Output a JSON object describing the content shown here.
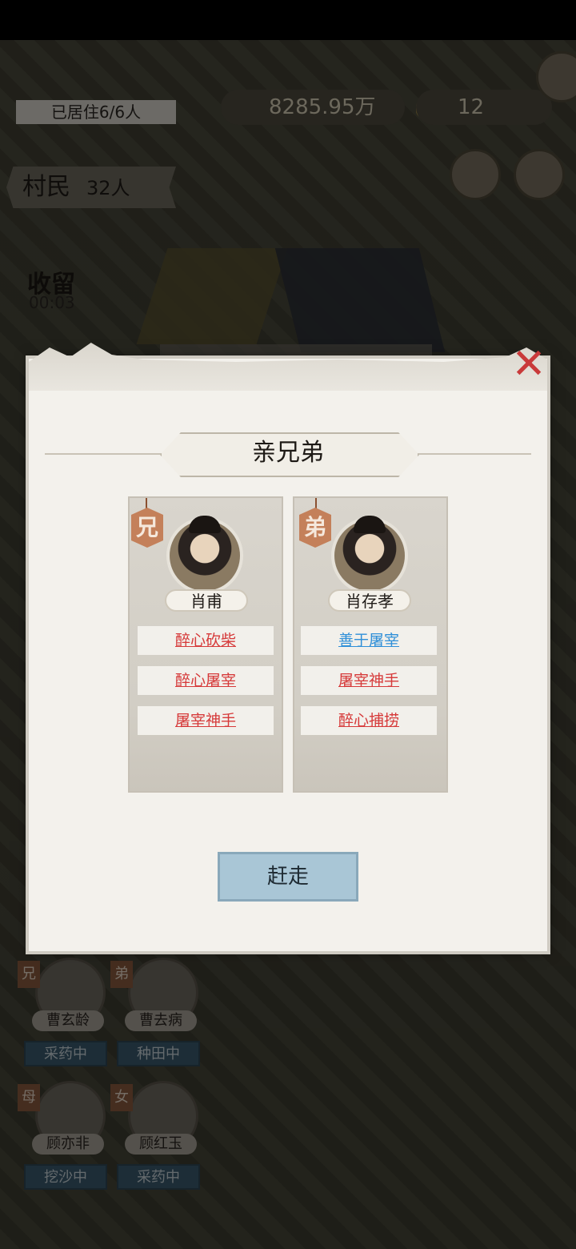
{
  "hud": {
    "residents": "已居住6/6人",
    "money": "8285.95万",
    "gold": "12",
    "villager_label": "村民",
    "villager_count": "32人",
    "keep_label": "收留",
    "keep_timer": "00:03"
  },
  "dialog": {
    "title": "亲兄弟",
    "expel_button": "赶走",
    "members": [
      {
        "rank": "兄",
        "name": "肖甫",
        "traits": [
          {
            "text": "醉心砍柴",
            "color": "#d63a3a"
          },
          {
            "text": "醉心屠宰",
            "color": "#d63a3a"
          },
          {
            "text": "屠宰神手",
            "color": "#d63a3a"
          }
        ]
      },
      {
        "rank": "弟",
        "name": "肖存孝",
        "traits": [
          {
            "text": "善于屠宰",
            "color": "#2f8fd8"
          },
          {
            "text": "屠宰神手",
            "color": "#d63a3a"
          },
          {
            "text": "醉心捕捞",
            "color": "#d63a3a"
          }
        ]
      }
    ]
  },
  "family": [
    {
      "rank": "兄",
      "name": "曹玄龄",
      "job": "采药中"
    },
    {
      "rank": "弟",
      "name": "曹去病",
      "job": "种田中"
    },
    {
      "rank": "母",
      "name": "顾亦非",
      "job": "挖沙中"
    },
    {
      "rank": "女",
      "name": "顾红玉",
      "job": "采药中"
    }
  ]
}
